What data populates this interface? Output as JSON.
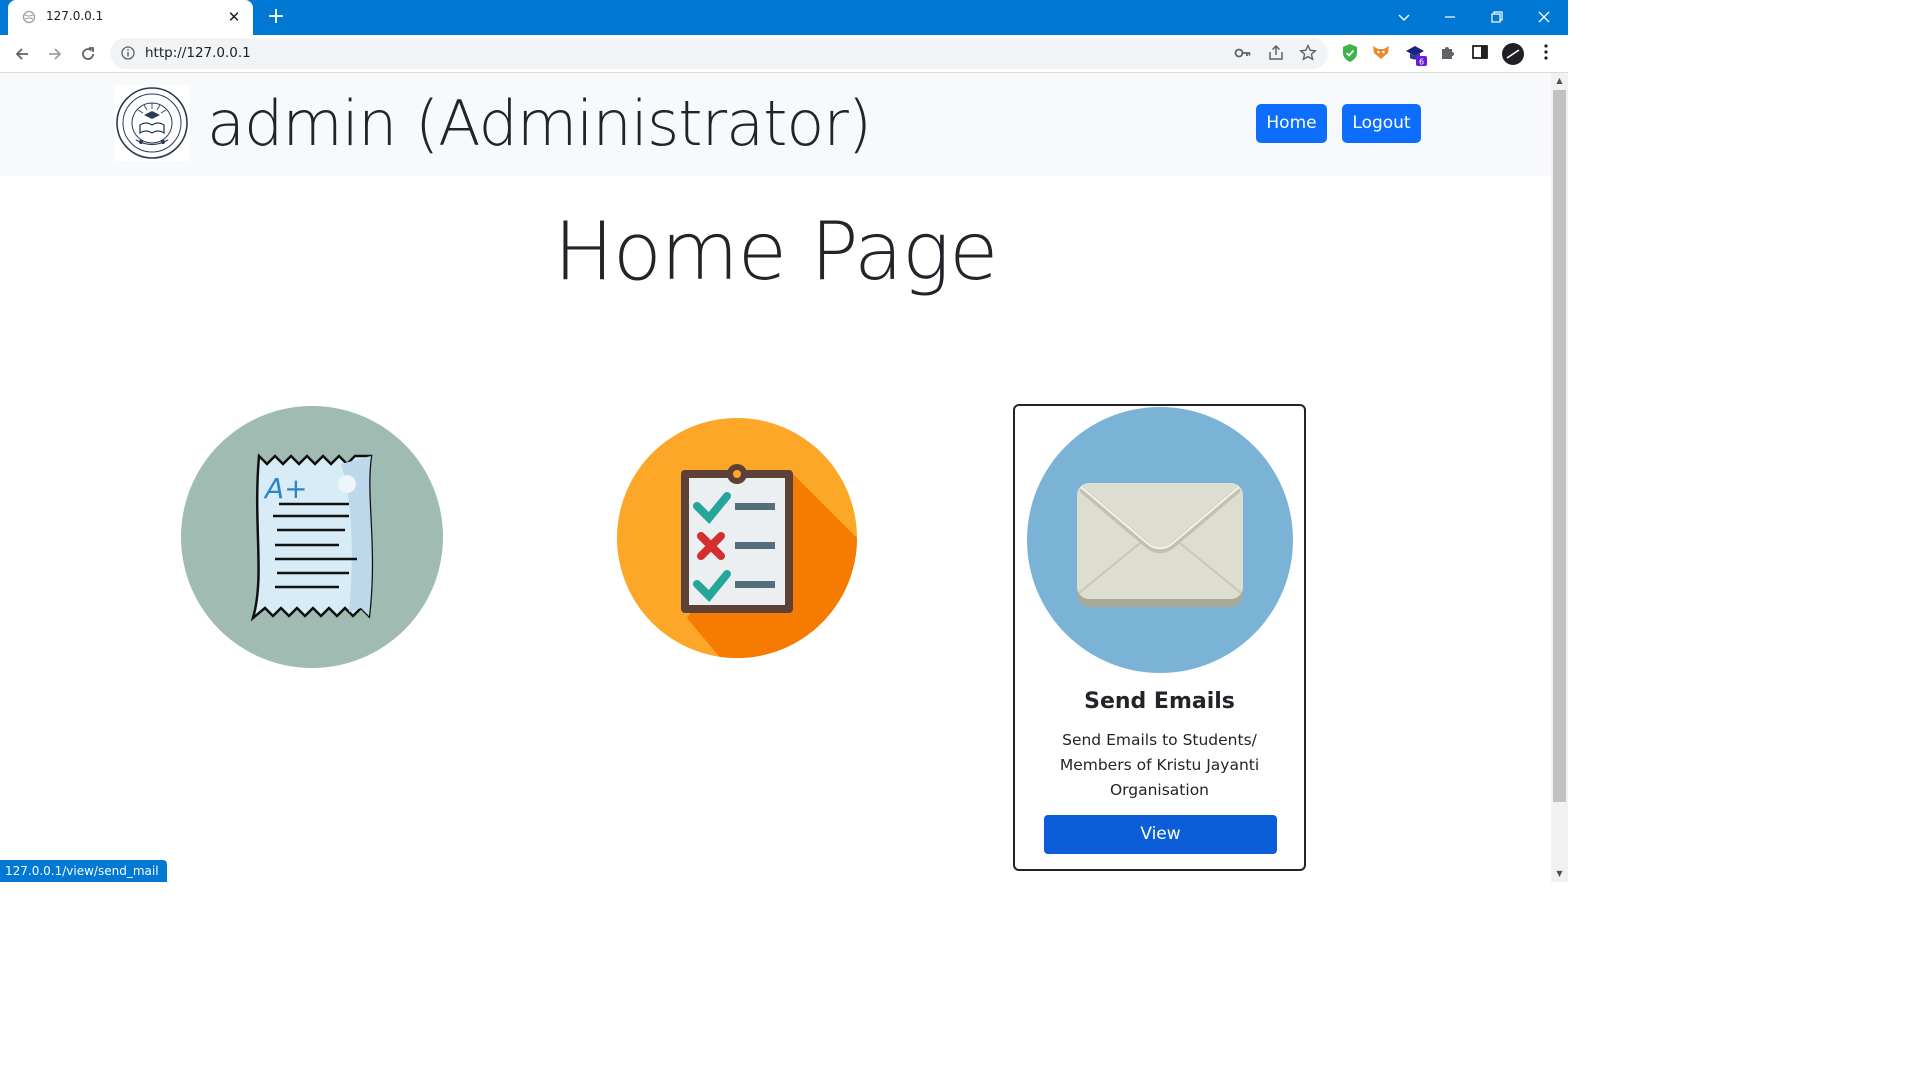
{
  "browser": {
    "tab_title": "127.0.0.1",
    "tab_close": "✕",
    "new_tab": "+",
    "url": "http://127.0.0.1",
    "status_url": "127.0.0.1/view/send_mail",
    "extension_badge": "6"
  },
  "header": {
    "brand_text": "admin (Administrator)",
    "nav": {
      "home_label": "Home",
      "logout_label": "Logout"
    }
  },
  "main": {
    "page_title": "Home Page",
    "cards": [
      {
        "icon": "report-card-icon"
      },
      {
        "icon": "clipboard-checklist-icon"
      },
      {
        "icon": "envelope-icon",
        "title": "Send Emails",
        "text": "Send Emails to Students/ Members of Kristu Jayanti Organisation",
        "button_label": "View"
      }
    ]
  },
  "colors": {
    "browser_accent": "#0078d4",
    "primary_button": "#0d6efd",
    "card_button": "#0b5ed7",
    "report_circle": "#9fbbb2",
    "clipboard_circle": "#fca728",
    "envelope_circle": "#7ab3d6"
  }
}
